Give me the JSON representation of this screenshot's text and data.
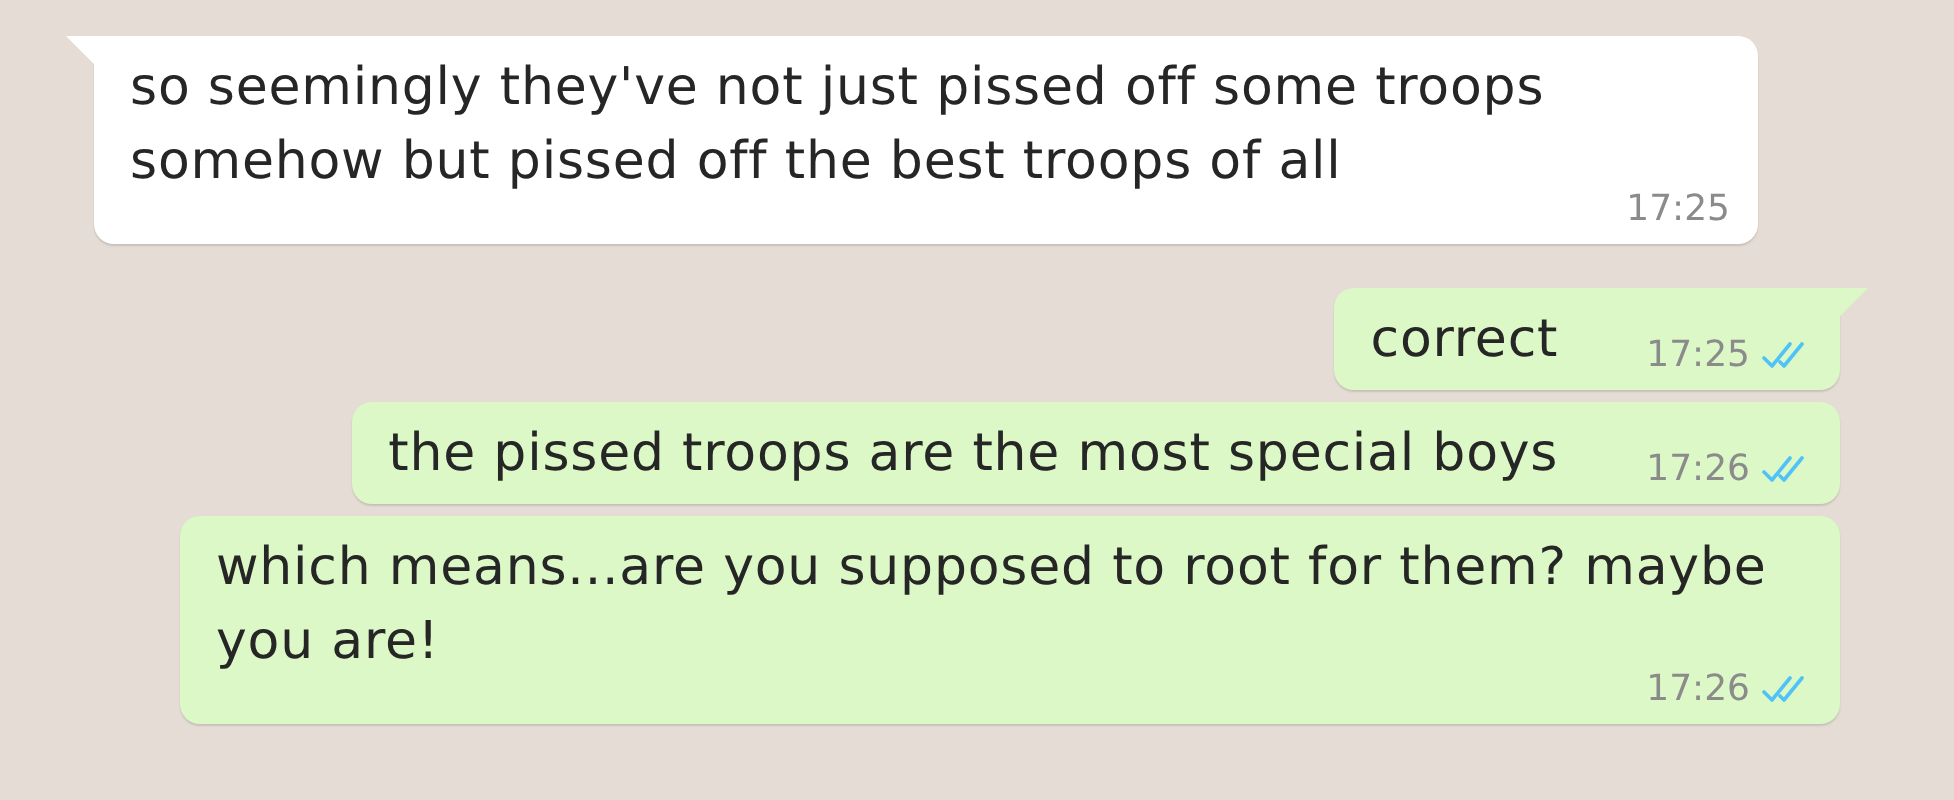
{
  "messages": [
    {
      "kind": "incoming",
      "text": "so seemingly they've not just pissed off some troops somehow but pissed off the best troops of all",
      "time": "17:25",
      "tail": true
    },
    {
      "kind": "outgoing",
      "text": "correct",
      "time": "17:25",
      "tail": true,
      "read": true
    },
    {
      "kind": "outgoing",
      "text": "the pissed troops are the most special boys",
      "time": "17:26",
      "tail": false,
      "read": true
    },
    {
      "kind": "outgoing",
      "text": "which means...are you supposed to root for them? maybe you are!",
      "time": "17:26",
      "tail": false,
      "read": true
    }
  ]
}
